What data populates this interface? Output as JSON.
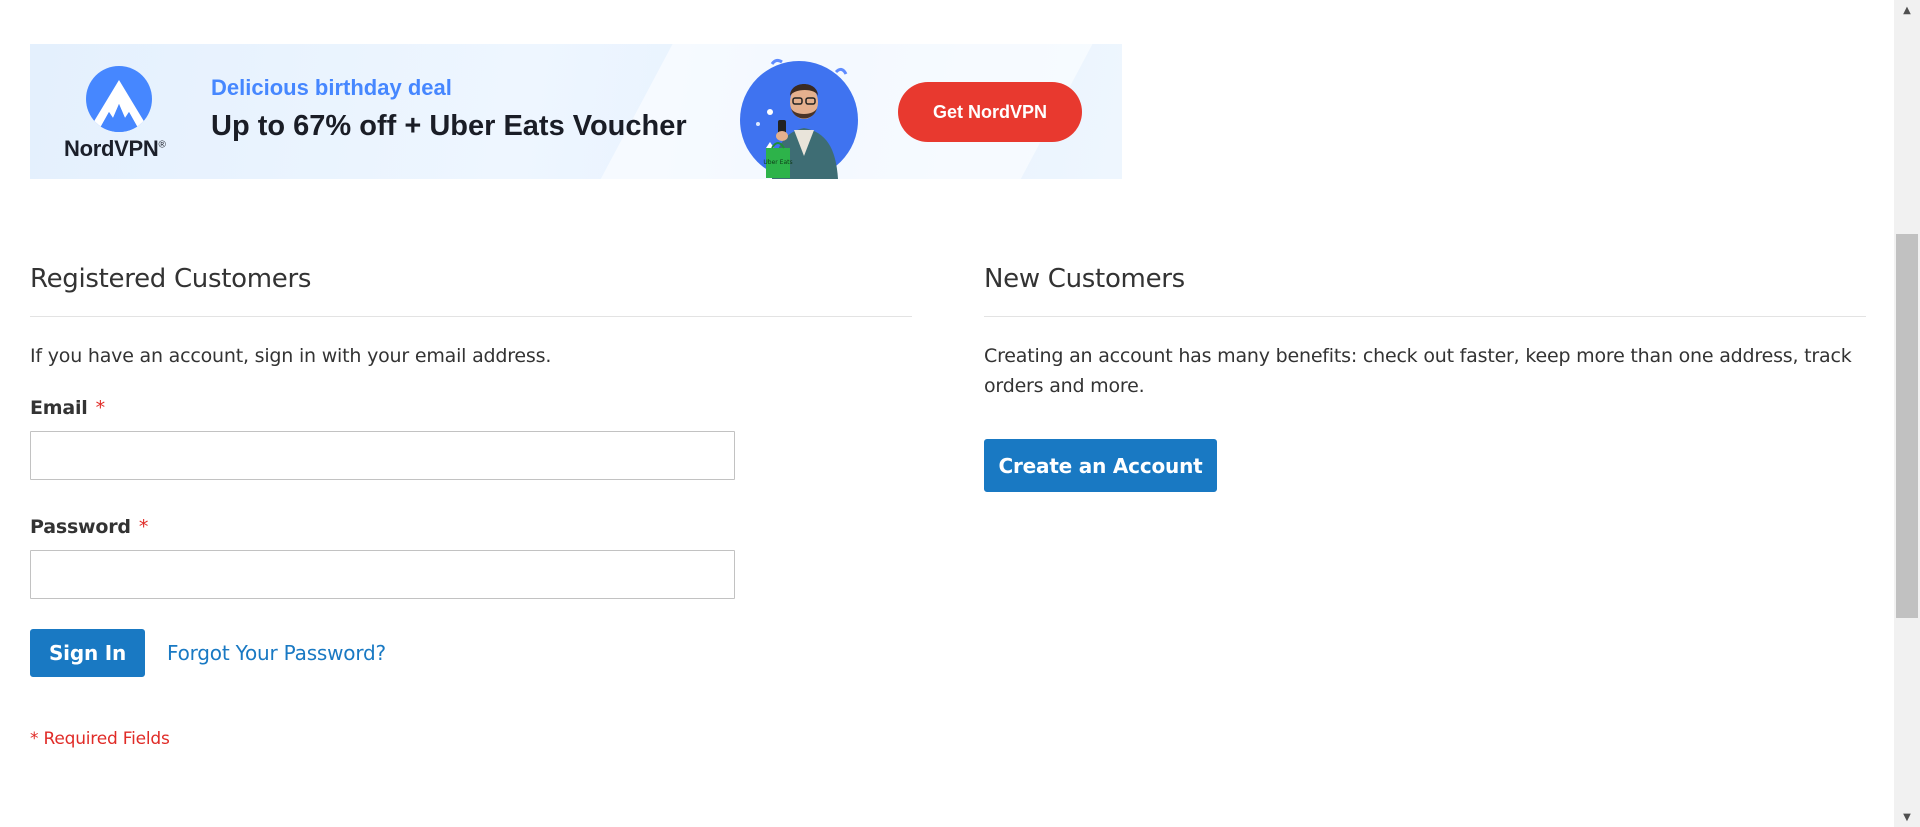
{
  "banner": {
    "brand": "NordVPN",
    "brand_mark": "®",
    "subtitle": "Delicious birthday deal",
    "headline": "Up to 67% off + Uber Eats Voucher",
    "cta": "Get NordVPN",
    "bag_text": "Uber Eats",
    "colors": {
      "subtitle": "#4687ff",
      "cta_bg": "#e8392f",
      "logo": "#4687ff"
    }
  },
  "registered": {
    "title": "Registered Customers",
    "intro": "If you have an account, sign in with your email address.",
    "email_label": "Email",
    "password_label": "Password",
    "required_mark": "*",
    "email_value": "",
    "password_value": "",
    "signin_label": "Sign In",
    "forgot_label": "Forgot Your Password?",
    "required_note": "* Required Fields"
  },
  "new_customers": {
    "title": "New Customers",
    "intro": "Creating an account has many benefits: check out faster, keep more than one address, track orders and more.",
    "create_label": "Create an Account"
  },
  "colors": {
    "primary": "#1979c3",
    "required": "#e02b27",
    "text": "#333333"
  },
  "scrollbar": {
    "up_icon": "triangle-up-icon",
    "down_icon": "triangle-down-icon"
  }
}
